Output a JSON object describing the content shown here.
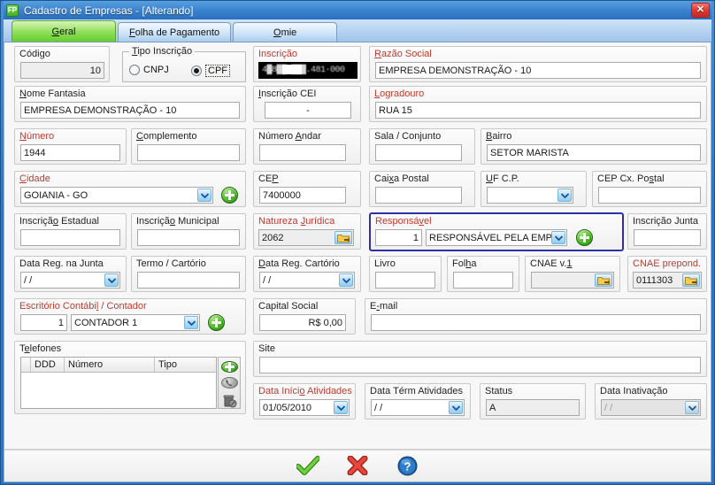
{
  "window": {
    "app_icon": "fp-app-icon",
    "icon_text": "FP",
    "title": "Cadastro de Empresas - [Alterando]",
    "close_label": "✕",
    "accent_blue": "#2f74c4",
    "required_color": "#c0392b",
    "highlight_border": "#2f30a8"
  },
  "tabs": [
    {
      "label": "Geral",
      "active": true
    },
    {
      "label": "Folha de Pagamento",
      "active": false
    },
    {
      "label": "Omie",
      "active": false
    }
  ],
  "fields": {
    "codigo": {
      "label": "Código",
      "value": "10",
      "required": false,
      "readonly": true
    },
    "tipo_inscricao": {
      "label": "Tipo Inscrição",
      "options": [
        "CNPJ",
        "CPF"
      ],
      "selected": "CPF"
    },
    "inscricao": {
      "label": "Inscrição",
      "value": "4█8██.███.481·000",
      "required": true,
      "redacted": true
    },
    "razao_social": {
      "label": "Razão Social",
      "value": "EMPRESA DEMONSTRAÇÃO - 10",
      "required": true
    },
    "nome_fantasia": {
      "label": "Nome Fantasia",
      "value": "EMPRESA DEMONSTRAÇÃO - 10",
      "required": false
    },
    "inscricao_cei": {
      "label": "Inscrição CEI",
      "value": "-",
      "required": false
    },
    "logradouro": {
      "label": "Logradouro",
      "value": "RUA 15",
      "required": true
    },
    "numero": {
      "label": "Número",
      "value": "1944",
      "required": true
    },
    "complemento": {
      "label": "Complemento",
      "value": "",
      "required": false
    },
    "numero_andar": {
      "label": "Número Andar",
      "value": "",
      "required": false
    },
    "sala_conjunto": {
      "label": "Sala / Conjunto",
      "value": "",
      "required": false
    },
    "bairro": {
      "label": "Bairro",
      "value": "SETOR MARISTA",
      "required": false
    },
    "cidade": {
      "label": "Cidade",
      "value": "GOIANIA - GO",
      "required": true
    },
    "cep": {
      "label": "CEP",
      "value": "7400000",
      "required": true
    },
    "caixa_postal": {
      "label": "Caixa Postal",
      "value": "",
      "required": false
    },
    "uf_cp": {
      "label": "UF C.P.",
      "value": "",
      "required": false
    },
    "cep_cx_postal": {
      "label": "CEP Cx. Postal",
      "value": "",
      "required": false
    },
    "inscricao_estadual": {
      "label": "Inscrição Estadual",
      "value": "",
      "required": false
    },
    "inscricao_municipal": {
      "label": "Inscrição Municipal",
      "value": "",
      "required": false
    },
    "natureza_juridica": {
      "label": "Natureza Jurídica",
      "value": "2062",
      "required": true,
      "lookup": "folder-icon"
    },
    "responsavel": {
      "label": "Responsável",
      "code": "1",
      "value": "RESPONSÁVEL PELA EMPRESA",
      "required": true,
      "highlighted": true,
      "add_button": "plus-icon"
    },
    "inscricao_junta": {
      "label": "Inscrição Junta",
      "value": "",
      "required": false
    },
    "data_reg_junta": {
      "label": "Data Reg. na Junta",
      "value": "  /  /",
      "required": false
    },
    "termo_cartorio": {
      "label": "Termo / Cartório",
      "value": "",
      "required": false
    },
    "data_reg_cartorio": {
      "label": "Data Reg. Cartório",
      "value": "  /  /",
      "required": false
    },
    "livro": {
      "label": "Livro",
      "value": "",
      "required": false
    },
    "folha": {
      "label": "Folha",
      "value": "",
      "required": false
    },
    "cnae_v1": {
      "label": "CNAE v.1",
      "value": "",
      "required": false,
      "lookup": "folder-icon",
      "readonly": true
    },
    "cnae_prepond": {
      "label": "CNAE prepond.",
      "value": "0111303",
      "required": true,
      "lookup": "folder-icon"
    },
    "escritorio_contabil": {
      "label": "Escritório Contábil / Contador",
      "code": "1",
      "value": "CONTADOR 1",
      "required": true,
      "add_button": "plus-icon"
    },
    "capital_social": {
      "label": "Capital Social",
      "value": "R$ 0,00",
      "required": false
    },
    "email": {
      "label": "E-mail",
      "value": "",
      "required": false
    },
    "site": {
      "label": "Site",
      "value": "",
      "required": false
    },
    "data_inicio_atividades": {
      "label": "Data Início Atividades",
      "value": "01/05/2010",
      "required": true
    },
    "data_term_atividades": {
      "label": "Data Térm Atividades",
      "value": "  /  /",
      "required": false
    },
    "status": {
      "label": "Status",
      "value": "A",
      "required": false,
      "readonly": true
    },
    "data_inativacao": {
      "label": "Data Inativação",
      "value": "  /  /",
      "required": false,
      "disabled": true
    }
  },
  "telefones": {
    "label": "Telefones",
    "columns": [
      "",
      "DDD",
      "Número",
      "Tipo"
    ],
    "rows": [],
    "buttons": [
      {
        "name": "add-phone-button",
        "icon": "plus-icon",
        "enabled": true
      },
      {
        "name": "edit-phone-button",
        "icon": "phone-edit-icon",
        "enabled": false
      },
      {
        "name": "delete-phone-button",
        "icon": "trash-icon",
        "enabled": false
      }
    ]
  },
  "bottom_bar": {
    "buttons": [
      {
        "name": "confirm-button",
        "icon": "check-icon",
        "tooltip": "Confirmar"
      },
      {
        "name": "cancel-button",
        "icon": "x-icon",
        "tooltip": "Cancelar"
      },
      {
        "name": "help-button",
        "icon": "help-icon",
        "tooltip": "Ajuda"
      }
    ]
  }
}
